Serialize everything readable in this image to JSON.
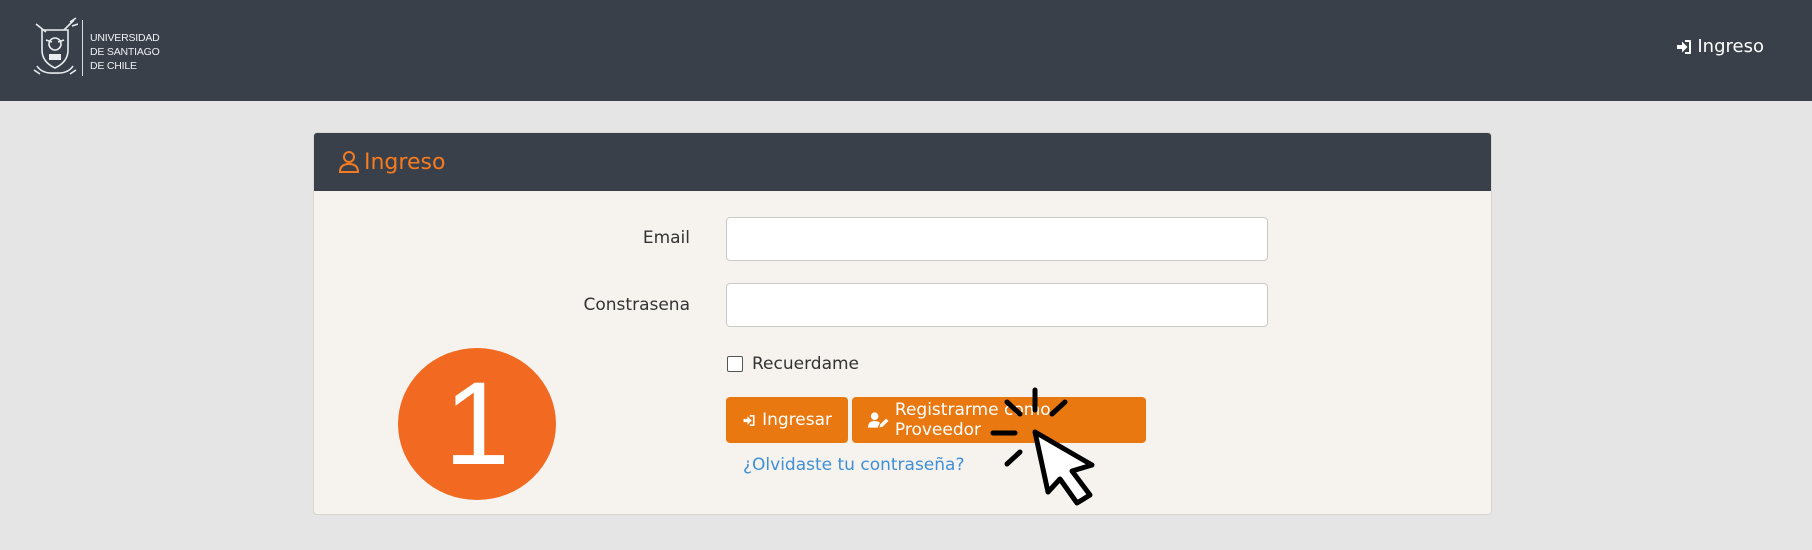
{
  "navbar": {
    "logo_lines": [
      "UNIVERSIDAD",
      "DE SANTIAGO",
      "DE CHILE"
    ],
    "login_icon": "sign-in-icon",
    "login_label": "Ingreso"
  },
  "card": {
    "header_icon": "user-icon",
    "title": "Ingreso"
  },
  "form": {
    "email_label": "Email",
    "email_value": "",
    "password_label": "Constrasena",
    "password_value": "",
    "remember_label": "Recuerdame",
    "remember_checked": false,
    "login_button_icon": "sign-in-icon",
    "login_button": "Ingresar",
    "register_button_icon": "user-edit-icon",
    "register_button": "Registrarme como Proveedor",
    "forgot_link": "¿Olvidaste tu contraseña?"
  },
  "overlay": {
    "step_number": "1",
    "cursor_icon": "click-cursor-icon"
  },
  "colors": {
    "navbar_bg": "#3a404a",
    "accent_orange": "#e8780f",
    "title_orange": "#f47b20",
    "link_blue": "#3f8fd6",
    "badge_orange": "#f26a22",
    "page_bg": "#e5e5e5",
    "card_bg": "#f6f3ef"
  }
}
